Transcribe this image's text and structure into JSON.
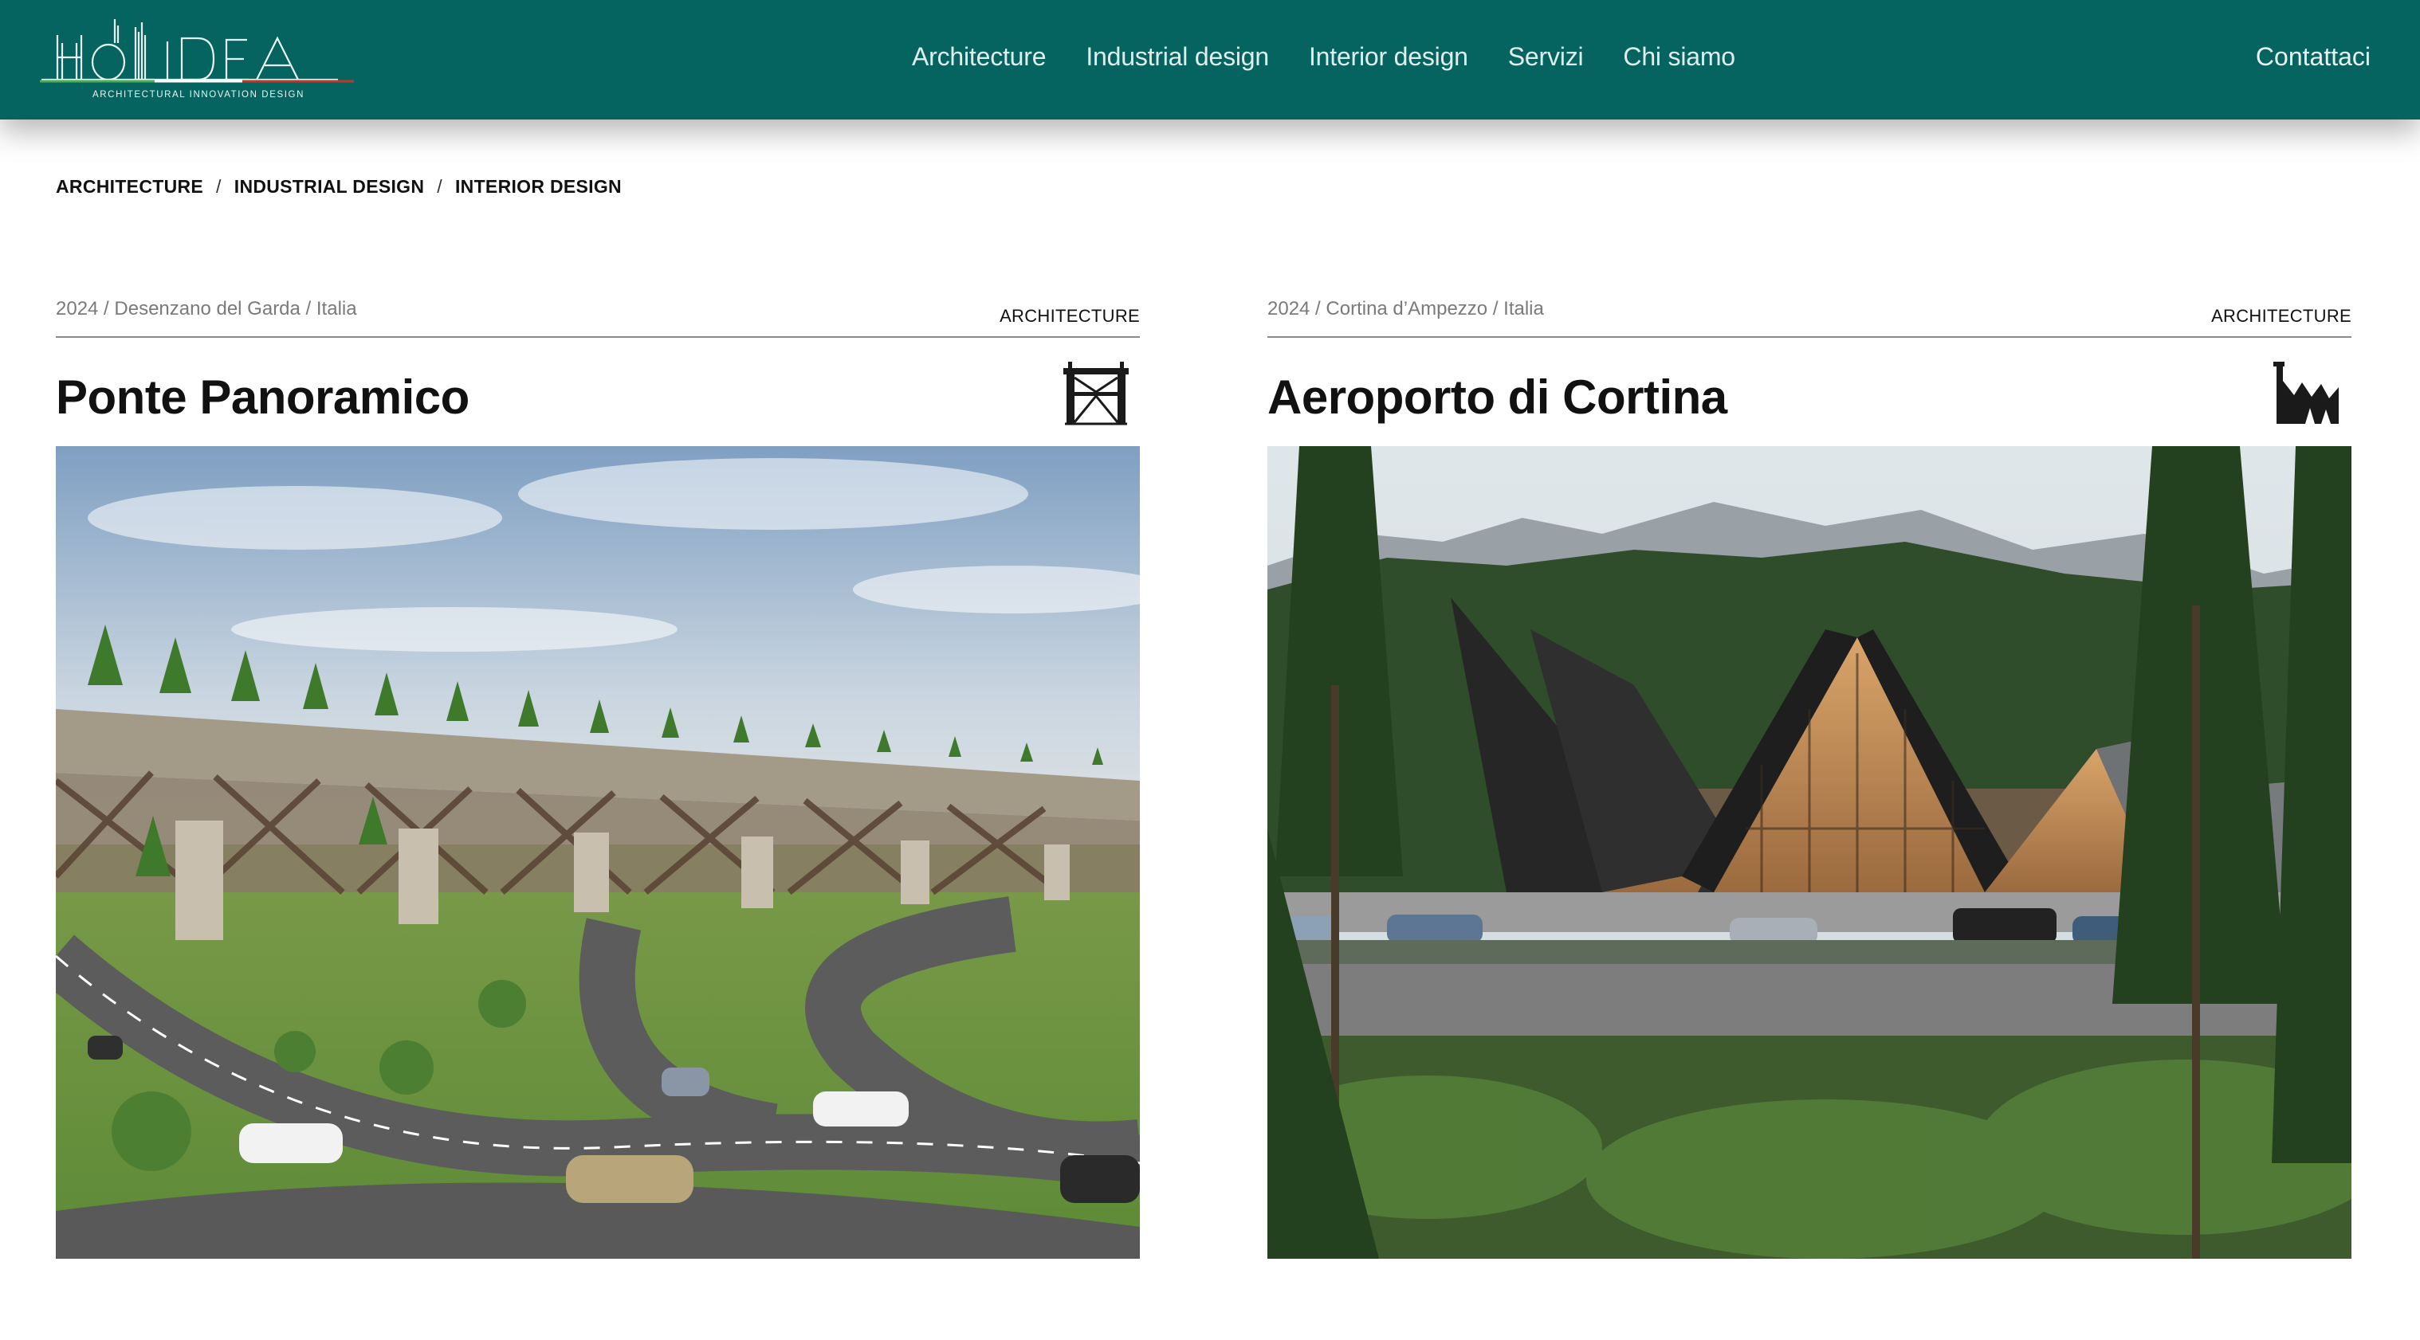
{
  "header": {
    "logo_text": "HOLIDEA",
    "logo_tagline": "ARCHITECTURAL INNOVATION DESIGN",
    "nav": [
      {
        "label": "Architecture"
      },
      {
        "label": "Industrial design"
      },
      {
        "label": "Interior design"
      },
      {
        "label": "Servizi"
      },
      {
        "label": "Chi siamo"
      }
    ],
    "contact_label": "Contattaci",
    "bg_color": "#05645f"
  },
  "filters": [
    {
      "label": "ARCHITECTURE"
    },
    {
      "label": "INDUSTRIAL DESIGN"
    },
    {
      "label": "INTERIOR DESIGN"
    }
  ],
  "filter_separator": "/",
  "projects": [
    {
      "meta": "2024 / Desenzano del Garda / Italia",
      "category": "ARCHITECTURE",
      "title": "Ponte Panoramico",
      "icon": "bridge-icon"
    },
    {
      "meta": "2024 / Cortina d’Ampezzo / Italia",
      "category": "ARCHITECTURE",
      "title": "Aeroporto di Cortina",
      "icon": "airport-icon"
    }
  ]
}
